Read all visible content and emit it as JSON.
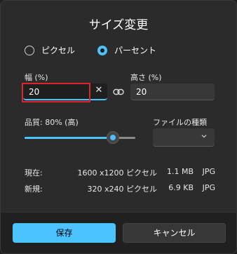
{
  "dialog": {
    "title": "サイズ変更"
  },
  "mode": {
    "pixel_label": "ピクセル",
    "percent_label": "パーセント",
    "selected": "percent"
  },
  "width": {
    "label": "幅 (%)",
    "value": "20"
  },
  "height": {
    "label": "高さ (%)",
    "value": "20"
  },
  "quality": {
    "label": "品質: 80% (高)",
    "value_percent": 80
  },
  "filetype": {
    "label": "ファイルの種類",
    "selected": ""
  },
  "current": {
    "label": "現在:",
    "dimensions": "1600 x1200 ピクセル",
    "size": "1.1 MB",
    "format": "JPG"
  },
  "new": {
    "label": "新規:",
    "dimensions": "320 x240 ピクセル",
    "size": "6.9 KB",
    "format": "JPG"
  },
  "buttons": {
    "save": "保存",
    "cancel": "キャンセル"
  },
  "colors": {
    "accent": "#4cc2ff",
    "highlight": "#e0242b",
    "background": "#2b2b2b"
  },
  "icons": {
    "clear": "close-icon",
    "link": "link-icon",
    "dropdown": "chevron-down-icon"
  }
}
